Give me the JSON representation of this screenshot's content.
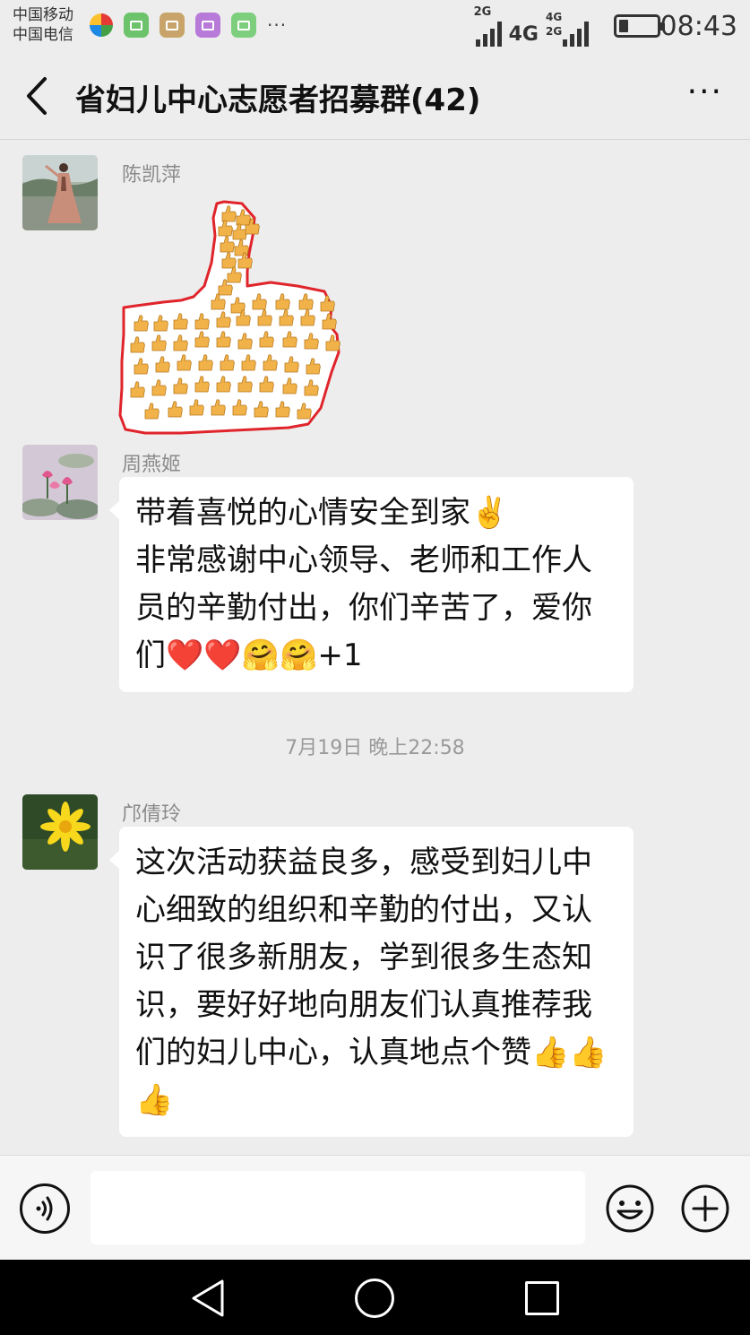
{
  "status_bar": {
    "carrier_1": "中国移动",
    "carrier_2": "中国电信",
    "sim1_network": "2G",
    "sim2_network_main": "4G",
    "sim2_network_small": "4G",
    "sim2_network_small_2": "2G",
    "more_icon": "···",
    "battery_level": 0.25,
    "time": "08:43"
  },
  "header": {
    "back_icon": "chevron-left-icon",
    "title": "省妇儿中心志愿者招募群(42)",
    "more_icon": "···"
  },
  "messages": [
    {
      "sender": "陈凯萍",
      "type": "sticker",
      "sticker": "thumbs-up-sticker"
    },
    {
      "sender": "周燕姬",
      "type": "text",
      "text": "带着喜悦的心情安全到家✌️\n非常感谢中心领导、老师和工作人\n员的辛勤付出，你们辛苦了，爱你\n们❤️❤️🤗🤗+1"
    },
    {
      "type": "timestamp",
      "text": "7月19日 晚上22:58"
    },
    {
      "sender": "邝倩玲",
      "type": "text",
      "text": "这次活动获益良多，感受到妇儿中\n心细致的组织和辛勤的付出，又认\n识了很多新朋友，学到很多生态知\n识，要好好地向朋友们认真推荐我\n们的妇儿中心，认真地点个赞👍👍\n👍"
    }
  ],
  "input_bar": {
    "voice_icon": "voice-icon",
    "text_value": "",
    "emoji_icon": "emoji-icon",
    "plus_icon": "plus-icon"
  },
  "nav_bar": {
    "back_icon": "nav-back-icon",
    "home_icon": "nav-home-icon",
    "recent_icon": "nav-recent-icon"
  },
  "colors": {
    "background": "#ededed",
    "bubble": "#ffffff",
    "sticker_outline": "#e0242b",
    "nav": "#000000"
  }
}
